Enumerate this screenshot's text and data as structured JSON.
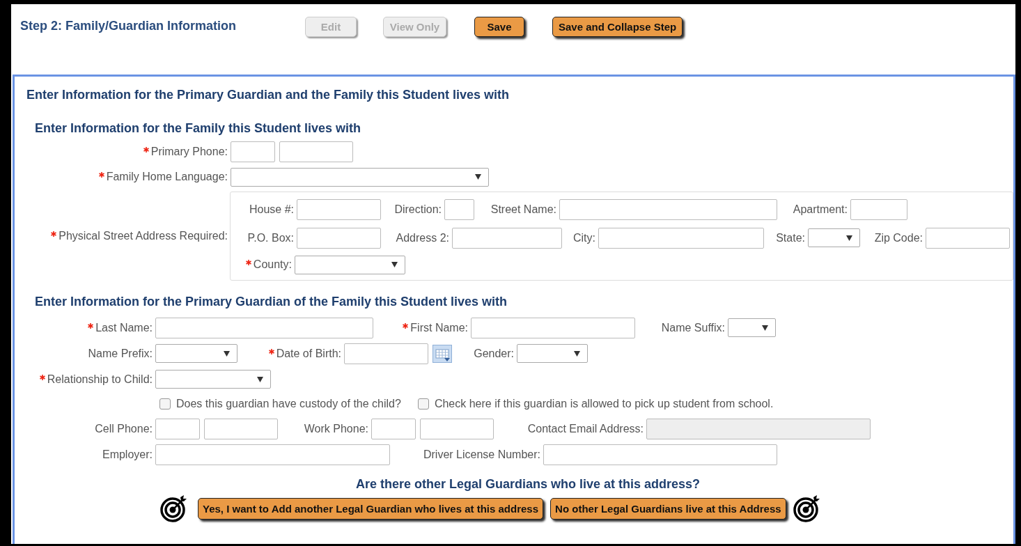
{
  "step": {
    "title": "Step 2: Family/Guardian Information",
    "buttons": [
      {
        "label": "Edit",
        "disabled": true
      },
      {
        "label": "View Only",
        "disabled": true
      },
      {
        "label": "Save",
        "disabled": false
      },
      {
        "label": "Save and Collapse Step",
        "disabled": false
      }
    ]
  },
  "panel_title": "Enter Information for the Primary Guardian and the Family this Student lives with",
  "family": {
    "heading": "Enter Information for the Family this Student lives with",
    "rows": [
      [
        {
          "label": "Primary Phone:",
          "required": true,
          "kind": "phone"
        }
      ],
      [
        {
          "label": "Family Home Language:",
          "required": true,
          "kind": "select"
        }
      ]
    ],
    "address": {
      "label": "Physical Street Address Required:",
      "required": true,
      "rows": [
        [
          {
            "label": "House #:",
            "required": false,
            "kind": "text"
          },
          {
            "label": "Direction:",
            "required": false,
            "kind": "text"
          },
          {
            "label": "Street Name:",
            "required": false,
            "kind": "text"
          },
          {
            "label": "Apartment:",
            "required": false,
            "kind": "text"
          }
        ],
        [
          {
            "label": "P.O. Box:",
            "required": false,
            "kind": "text"
          },
          {
            "label": "Address 2:",
            "required": false,
            "kind": "text"
          },
          {
            "label": "City:",
            "required": false,
            "kind": "text"
          },
          {
            "label": "State:",
            "required": false,
            "kind": "select"
          },
          {
            "label": "Zip Code:",
            "required": false,
            "kind": "text"
          }
        ],
        [
          {
            "label": "County:",
            "required": true,
            "kind": "select"
          }
        ]
      ]
    }
  },
  "guardian": {
    "heading": "Enter Information for the Primary Guardian of the Family this Student lives with",
    "rows": [
      [
        {
          "label": "Last Name:",
          "required": true,
          "kind": "text"
        },
        {
          "label": "First Name:",
          "required": true,
          "kind": "text"
        },
        {
          "label": "Name Suffix:",
          "required": false,
          "kind": "select"
        }
      ],
      [
        {
          "label": "Name Prefix:",
          "required": false,
          "kind": "select"
        },
        {
          "label": "Date of Birth:",
          "required": true,
          "kind": "date"
        },
        {
          "label": "Gender:",
          "required": false,
          "kind": "select"
        }
      ],
      [
        {
          "label": "Relationship to Child:",
          "required": true,
          "kind": "select"
        }
      ],
      [
        {
          "label": "Does this guardian have custody of the child?",
          "required": false,
          "kind": "checkbox",
          "checked": false
        },
        {
          "label": "Check here if this guardian is allowed to pick up student from school.",
          "required": false,
          "kind": "checkbox",
          "checked": false
        }
      ],
      [
        {
          "label": "Cell Phone:",
          "required": false,
          "kind": "phone"
        },
        {
          "label": "Work Phone:",
          "required": false,
          "kind": "phone"
        },
        {
          "label": "Contact Email Address:",
          "required": false,
          "kind": "readonly"
        }
      ],
      [
        {
          "label": "Employer:",
          "required": false,
          "kind": "text"
        },
        {
          "label": "Driver License Number:",
          "required": false,
          "kind": "text"
        }
      ]
    ]
  },
  "question": "Are there other Legal Guardians who live at this address?",
  "answers": [
    "Yes, I want to Add another Legal Guardian who lives at this address",
    "No other Legal Guardians live at this Address"
  ]
}
